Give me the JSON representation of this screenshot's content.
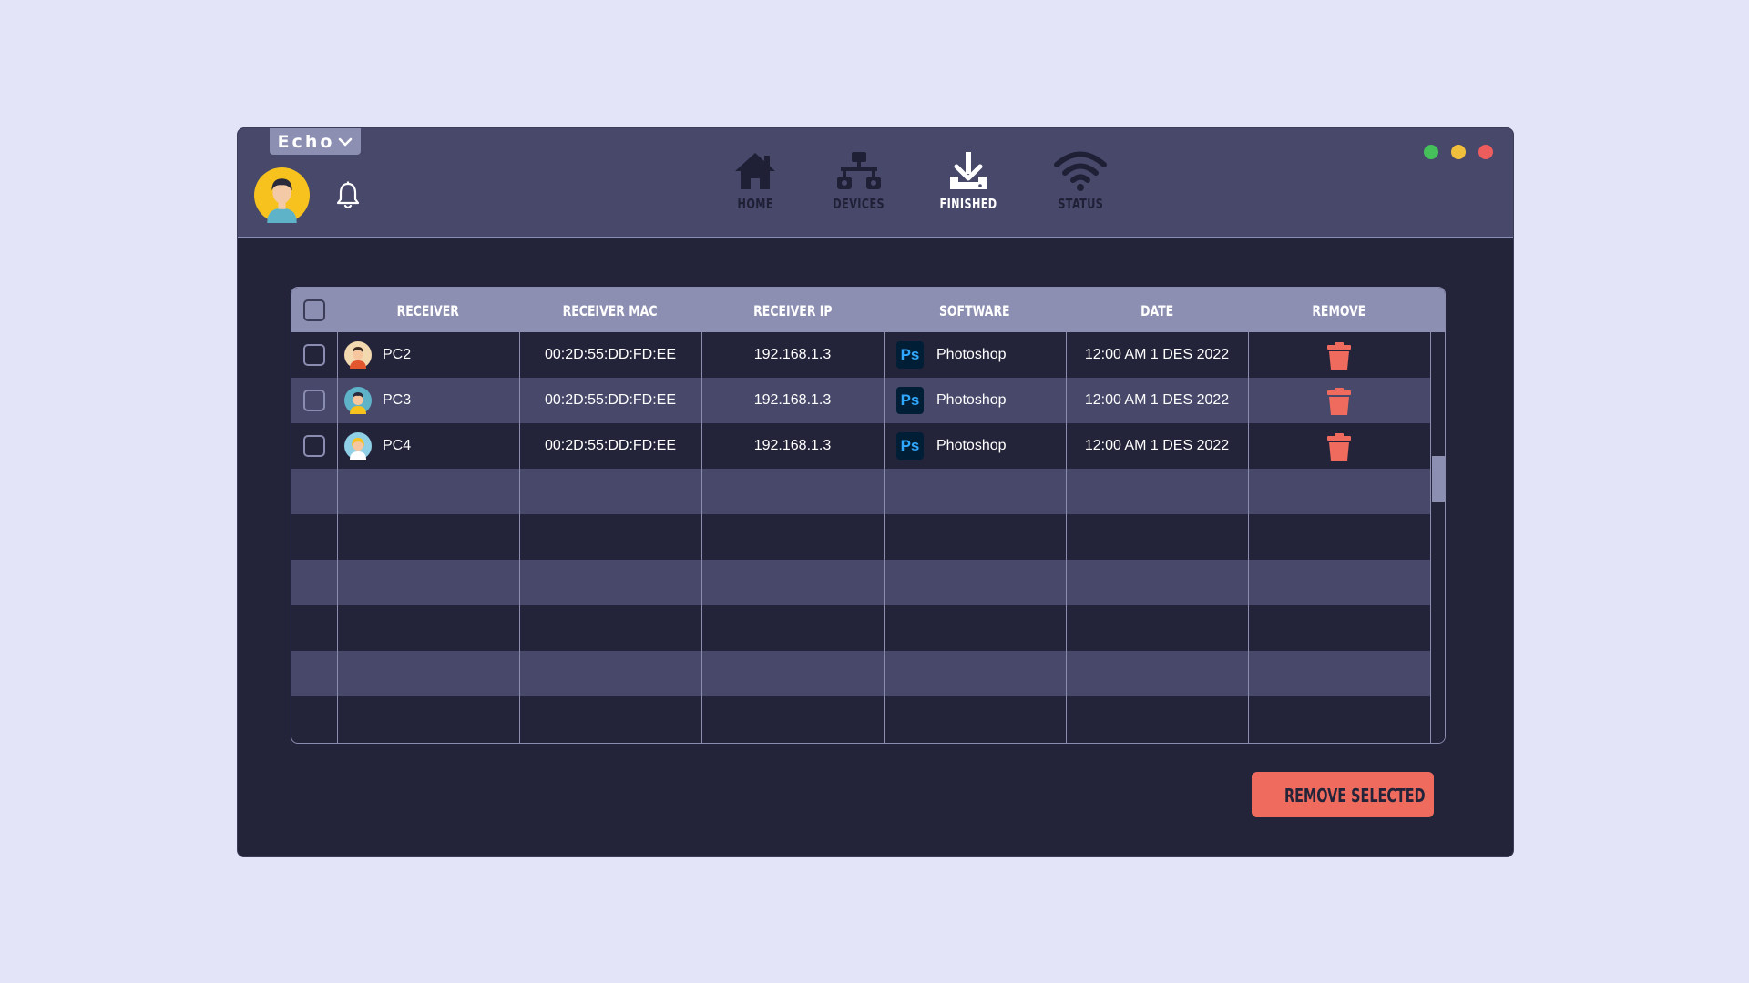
{
  "app": {
    "name": "Echo"
  },
  "nav": {
    "items": [
      {
        "label": "HOME",
        "icon": "home-icon",
        "active": false
      },
      {
        "label": "DEVICES",
        "icon": "network-icon",
        "active": false
      },
      {
        "label": "FINISHED",
        "icon": "download-icon",
        "active": true
      },
      {
        "label": "STATUS",
        "icon": "wifi-icon",
        "active": false
      }
    ]
  },
  "window_controls": {
    "colors": [
      "#45c05b",
      "#f0c03c",
      "#ee5d5d"
    ]
  },
  "table": {
    "headers": [
      "RECEIVER",
      "RECEIVER MAC",
      "RECEIVER IP",
      "SOFTWARE",
      "DATE",
      "REMOVE"
    ],
    "rows": [
      {
        "receiver": "PC2",
        "mac": "00:2D:55:DD:FD:EE",
        "ip": "192.168.1.3",
        "software_icon": "Ps",
        "software": "Photoshop",
        "date": "12:00 AM 1 DES 2022"
      },
      {
        "receiver": "PC3",
        "mac": "00:2D:55:DD:FD:EE",
        "ip": "192.168.1.3",
        "software_icon": "Ps",
        "software": "Photoshop",
        "date": "12:00 AM 1 DES 2022"
      },
      {
        "receiver": "PC4",
        "mac": "00:2D:55:DD:FD:EE",
        "ip": "192.168.1.3",
        "software_icon": "Ps",
        "software": "Photoshop",
        "date": "12:00 AM 1 DES 2022"
      }
    ]
  },
  "actions": {
    "remove_selected": "REMOVE SELECTED"
  },
  "colors": {
    "background": "#e3e4f7",
    "window": "#232439",
    "header": "#47486a",
    "table_header": "#8d8fb2",
    "accent": "#ee6b5e"
  }
}
